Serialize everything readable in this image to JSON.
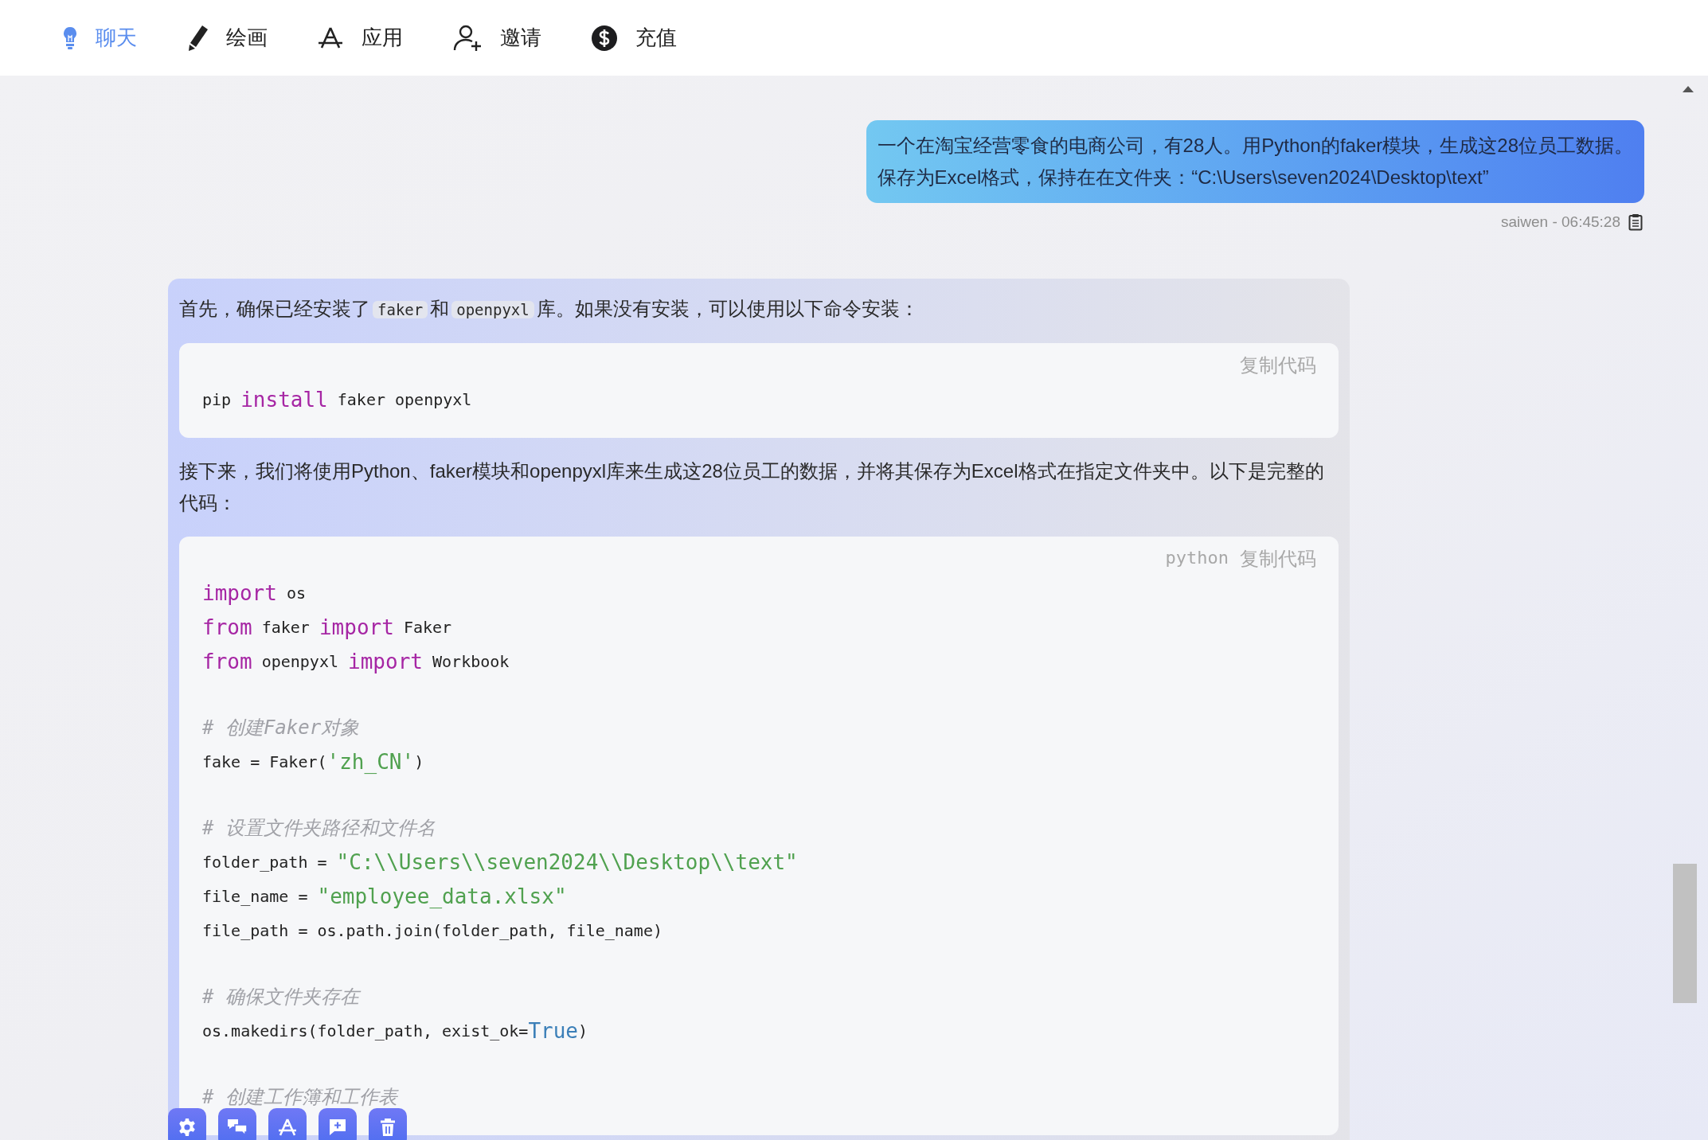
{
  "nav": [
    {
      "label": "聊天",
      "kind": "bulb",
      "selected": true
    },
    {
      "label": "绘画",
      "kind": "pencil",
      "selected": false
    },
    {
      "label": "应用",
      "kind": "apps",
      "selected": false
    },
    {
      "label": "邀请",
      "kind": "invite",
      "selected": false
    },
    {
      "label": "充值",
      "kind": "dollar",
      "selected": false
    }
  ],
  "user_message": {
    "lines": [
      "一个在淘宝经营零食的电商公司，有28人。用Python的faker模块，生成这28位员工数据。",
      "保存为Excel格式，保持在在文件夹：“C:\\Users\\seven2024\\Desktop\\text”"
    ],
    "meta": "saiwen - 06:45:28"
  },
  "assistant_message": {
    "blocks": [
      {
        "kind": "paragraph",
        "segments": [
          {
            "kind": "text",
            "text": "首先，确保已经安装了"
          },
          {
            "kind": "code",
            "text": "faker"
          },
          {
            "kind": "text",
            "text": "和"
          },
          {
            "kind": "code",
            "text": "openpyxl"
          },
          {
            "kind": "text",
            "text": "库。如果没有安装，可以使用以下命令安装："
          }
        ]
      },
      {
        "kind": "code",
        "copy_label": "复制代码",
        "groups": [
          [
            [
              {
                "kind": "plain",
                "text": "pip "
              },
              {
                "kind": "keyword",
                "text": "install"
              },
              {
                "kind": "plain",
                "text": " faker openpyxl"
              }
            ]
          ]
        ]
      },
      {
        "kind": "paragraph",
        "segments": [
          {
            "kind": "text",
            "text": "接下来，我们将使用Python、faker模块和openpyxl库来生成这28位员工的数据，并将其保存为Excel格式在指定文件夹中。以下是完整的代码："
          }
        ]
      },
      {
        "kind": "code",
        "language": "python",
        "copy_label": "复制代码",
        "groups": [
          [
            [
              {
                "kind": "keyword",
                "text": "import"
              },
              {
                "kind": "plain",
                "text": " os"
              }
            ],
            [
              {
                "kind": "keyword",
                "text": "from"
              },
              {
                "kind": "plain",
                "text": " faker "
              },
              {
                "kind": "keyword",
                "text": "import"
              },
              {
                "kind": "plain",
                "text": " Faker"
              }
            ],
            [
              {
                "kind": "keyword",
                "text": "from"
              },
              {
                "kind": "plain",
                "text": " openpyxl "
              },
              {
                "kind": "keyword",
                "text": "import"
              },
              {
                "kind": "plain",
                "text": " Workbook"
              }
            ]
          ],
          [
            [
              {
                "kind": "comment",
                "text": "# 创建Faker对象"
              }
            ],
            [
              {
                "kind": "plain",
                "text": "fake = Faker("
              },
              {
                "kind": "string",
                "text": "'zh_CN'"
              },
              {
                "kind": "plain",
                "text": ")"
              }
            ]
          ],
          [
            [
              {
                "kind": "comment",
                "text": "# 设置文件夹路径和文件名"
              }
            ],
            [
              {
                "kind": "plain",
                "text": "folder_path = "
              },
              {
                "kind": "string",
                "text": "\"C:\\\\Users\\\\seven2024\\\\Desktop\\\\text\""
              }
            ],
            [
              {
                "kind": "plain",
                "text": "file_name = "
              },
              {
                "kind": "string",
                "text": "\"employee_data.xlsx\""
              }
            ],
            [
              {
                "kind": "plain",
                "text": "file_path = os.path.join(folder_path, file_name)"
              }
            ]
          ],
          [
            [
              {
                "kind": "comment",
                "text": "# 确保文件夹存在"
              }
            ],
            [
              {
                "kind": "plain",
                "text": "os.makedirs(folder_path, exist_ok="
              },
              {
                "kind": "constant",
                "text": "True"
              },
              {
                "kind": "plain",
                "text": ")"
              }
            ]
          ],
          [
            [
              {
                "kind": "comment",
                "text": "# 创建工作簿和工作表"
              }
            ]
          ]
        ]
      }
    ]
  }
}
